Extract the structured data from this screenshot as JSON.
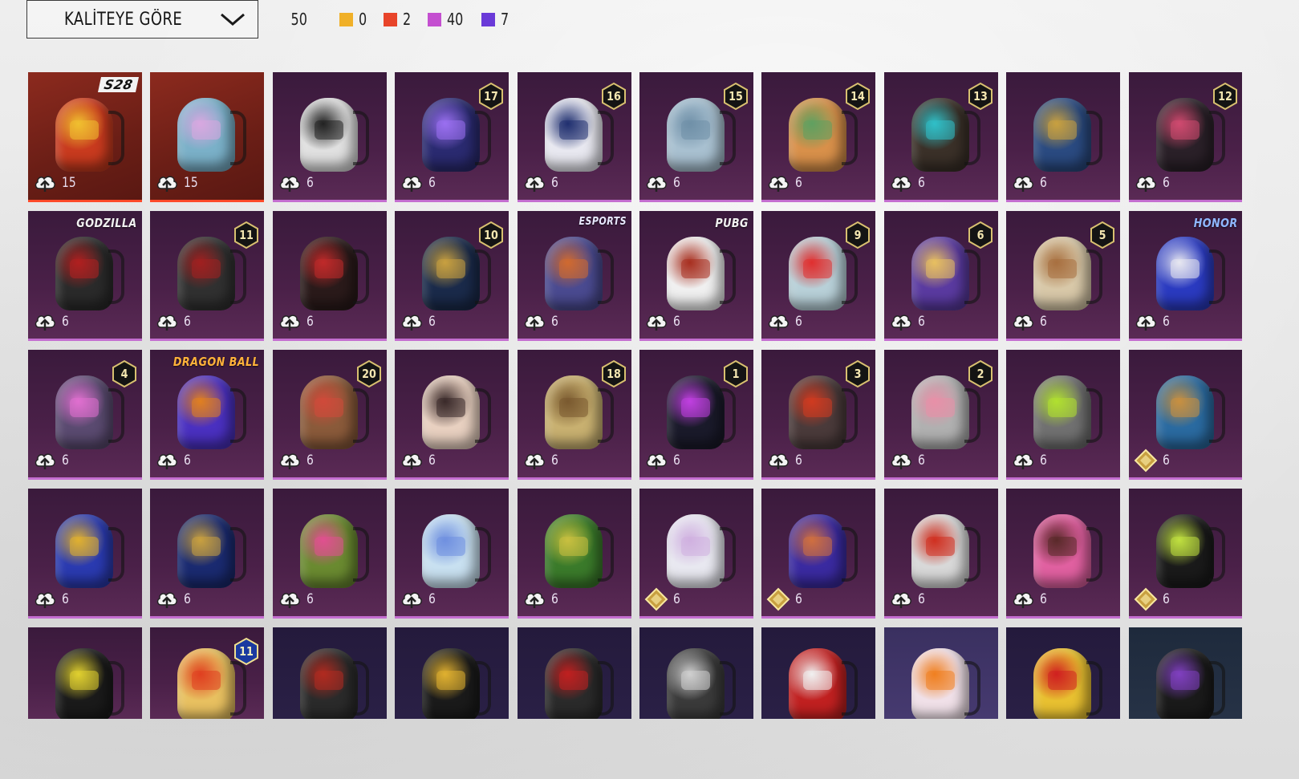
{
  "sort": {
    "label": "KALİTEYE GÖRE"
  },
  "counts": {
    "total": "50",
    "items": [
      {
        "color": "#f0b028",
        "value": "0"
      },
      {
        "color": "#e8442a",
        "value": "2"
      },
      {
        "color": "#c44fd0",
        "value": "40"
      },
      {
        "color": "#6a3ad8",
        "value": "7"
      }
    ]
  },
  "items": [
    {
      "tier": "red",
      "badge": "S28",
      "badge_type": "tag",
      "cost_icon": "upgrade",
      "cost": "15",
      "pack": "#c83a1e",
      "accent": "#f0c030"
    },
    {
      "tier": "red",
      "cost_icon": "upgrade",
      "cost": "15",
      "pack": "#7ab0c8",
      "accent": "#d8a8e0"
    },
    {
      "tier": "purple",
      "cost_icon": "upgrade",
      "cost": "6",
      "pack": "#e0e0e0",
      "accent": "#222222"
    },
    {
      "tier": "purple",
      "level": "17",
      "cost_icon": "upgrade",
      "cost": "6",
      "pack": "#2a2a70",
      "accent": "#9a70f0"
    },
    {
      "tier": "purple",
      "level": "16",
      "cost_icon": "upgrade",
      "cost": "6",
      "pack": "#e8e8f0",
      "accent": "#203070"
    },
    {
      "tier": "purple",
      "level": "15",
      "cost_icon": "upgrade",
      "cost": "6",
      "pack": "#a8c0d0",
      "accent": "#7090a8"
    },
    {
      "tier": "purple",
      "level": "14",
      "cost_icon": "upgrade",
      "cost": "6",
      "pack": "#d8904a",
      "accent": "#60a060"
    },
    {
      "tier": "purple",
      "level": "13",
      "cost_icon": "upgrade",
      "cost": "6",
      "pack": "#3a3028",
      "accent": "#30c0c8"
    },
    {
      "tier": "purple",
      "cost_icon": "upgrade",
      "cost": "6",
      "pack": "#2a4a80",
      "accent": "#c8a040"
    },
    {
      "tier": "purple",
      "level": "12",
      "cost_icon": "upgrade",
      "cost": "6",
      "pack": "#2a2028",
      "accent": "#d04a70"
    },
    {
      "tier": "purple",
      "badge": "GODZILLA",
      "badge_type": "text",
      "cost_icon": "upgrade",
      "cost": "6",
      "pack": "#2a2a2a",
      "accent": "#b02020"
    },
    {
      "tier": "purple",
      "level": "11",
      "cost_icon": "upgrade",
      "cost": "6",
      "pack": "#303030",
      "accent": "#a02020"
    },
    {
      "tier": "purple",
      "cost_icon": "upgrade",
      "cost": "6",
      "pack": "#2a1a1a",
      "accent": "#c02a2a"
    },
    {
      "tier": "purple",
      "level": "10",
      "cost_icon": "upgrade",
      "cost": "6",
      "pack": "#1a2a4a",
      "accent": "#c8a040"
    },
    {
      "tier": "purple",
      "badge": "ESPORTS",
      "badge_type": "esports",
      "cost_icon": "upgrade",
      "cost": "6",
      "pack": "#4a4a90",
      "accent": "#d06a30"
    },
    {
      "tier": "purple",
      "badge": "PUBG",
      "badge_type": "text",
      "cost_icon": "upgrade",
      "cost": "6",
      "pack": "#f0f0f0",
      "accent": "#a83020"
    },
    {
      "tier": "purple",
      "level": "9",
      "cost_icon": "upgrade",
      "cost": "6",
      "pack": "#b8d0d8",
      "accent": "#e03030"
    },
    {
      "tier": "purple",
      "level": "6",
      "cost_icon": "upgrade",
      "cost": "6",
      "pack": "#5a3aa0",
      "accent": "#e8c060"
    },
    {
      "tier": "purple",
      "level": "5",
      "cost_icon": "upgrade",
      "cost": "6",
      "pack": "#d8c8a8",
      "accent": "#a87040"
    },
    {
      "tier": "purple",
      "badge": "HONOR",
      "badge_type": "blue",
      "cost_icon": "upgrade",
      "cost": "6",
      "pack": "#2a3ac0",
      "accent": "#e8e8f0"
    },
    {
      "tier": "purple",
      "level": "4",
      "cost_icon": "upgrade",
      "cost": "6",
      "pack": "#5a4a70",
      "accent": "#e070d0"
    },
    {
      "tier": "purple",
      "badge": "DRAGON BALL",
      "badge_type": "orange",
      "cost_icon": "upgrade",
      "cost": "6",
      "pack": "#4a30c0",
      "accent": "#e08020"
    },
    {
      "tier": "purple",
      "level": "20",
      "cost_icon": "upgrade",
      "cost": "6",
      "pack": "#8a5a3a",
      "accent": "#d04a3a"
    },
    {
      "tier": "purple",
      "cost_icon": "upgrade",
      "cost": "6",
      "pack": "#e8d0c0",
      "accent": "#3a2a2a"
    },
    {
      "tier": "purple",
      "level": "18",
      "cost_icon": "upgrade",
      "cost": "6",
      "pack": "#c8b070",
      "accent": "#7a5a30"
    },
    {
      "tier": "purple",
      "level": "1",
      "cost_icon": "upgrade",
      "cost": "6",
      "pack": "#1a1a2a",
      "accent": "#c040e0"
    },
    {
      "tier": "purple",
      "level": "3",
      "cost_icon": "upgrade",
      "cost": "6",
      "pack": "#4a3a3a",
      "accent": "#d03a20"
    },
    {
      "tier": "purple",
      "level": "2",
      "cost_icon": "upgrade",
      "cost": "6",
      "pack": "#b0b0b0",
      "accent": "#e890a8"
    },
    {
      "tier": "purple",
      "cost_icon": "upgrade",
      "cost": "6",
      "pack": "#707070",
      "accent": "#b0e030"
    },
    {
      "tier": "purple",
      "cost_icon": "coin",
      "cost": "6",
      "pack": "#2a6aa0",
      "accent": "#c89040"
    },
    {
      "tier": "purple",
      "cost_icon": "upgrade",
      "cost": "6",
      "pack": "#2a3ab0",
      "accent": "#e0b030"
    },
    {
      "tier": "purple",
      "cost_icon": "upgrade",
      "cost": "6",
      "pack": "#1a2a70",
      "accent": "#c8a040"
    },
    {
      "tier": "purple",
      "cost_icon": "upgrade",
      "cost": "6",
      "pack": "#6a8a30",
      "accent": "#e05090"
    },
    {
      "tier": "purple",
      "cost_icon": "upgrade",
      "cost": "6",
      "pack": "#c8e0f0",
      "accent": "#7090e0"
    },
    {
      "tier": "purple",
      "cost_icon": "upgrade",
      "cost": "6",
      "pack": "#3a7a2a",
      "accent": "#c8c040"
    },
    {
      "tier": "purple",
      "cost_icon": "coin",
      "cost": "6",
      "pack": "#e8e8f0",
      "accent": "#d0b0e0"
    },
    {
      "tier": "purple",
      "cost_icon": "coin",
      "cost": "6",
      "pack": "#3a2aa0",
      "accent": "#d07040"
    },
    {
      "tier": "purple",
      "cost_icon": "upgrade",
      "cost": "6",
      "pack": "#d8d8d8",
      "accent": "#d03020"
    },
    {
      "tier": "purple",
      "cost_icon": "upgrade",
      "cost": "6",
      "pack": "#e060a0",
      "accent": "#5a2a2a"
    },
    {
      "tier": "purple",
      "cost_icon": "coin",
      "cost": "6",
      "pack": "#1a1a1a",
      "accent": "#c0e040"
    },
    {
      "tier": "purple",
      "cost_icon": "none",
      "pack": "#1a1a1a",
      "accent": "#e0d030"
    },
    {
      "tier": "purple",
      "level": "11",
      "level_type": "blue",
      "cost_icon": "none",
      "pack": "#e8c060",
      "accent": "#e04020"
    },
    {
      "tier": "dark",
      "cost_icon": "none",
      "pack": "#2a2a2a",
      "accent": "#b02a20"
    },
    {
      "tier": "dark",
      "cost_icon": "none",
      "pack": "#1a1a1a",
      "accent": "#e0b030"
    },
    {
      "tier": "dark",
      "cost_icon": "none",
      "pack": "#2a2a2a",
      "accent": "#c02020"
    },
    {
      "tier": "dark",
      "cost_icon": "none",
      "pack": "#3a3a3a",
      "accent": "#d0d0d0"
    },
    {
      "tier": "dark",
      "cost_icon": "none",
      "pack": "#c02020",
      "accent": "#f0f0f0"
    },
    {
      "tier": "lav",
      "cost_icon": "none",
      "pack": "#f0e0e8",
      "accent": "#f08020"
    },
    {
      "tier": "dark",
      "cost_icon": "none",
      "pack": "#e8c030",
      "accent": "#d02020"
    },
    {
      "tier": "blue",
      "cost_icon": "none",
      "pack": "#1a1a1a",
      "accent": "#8040c0"
    }
  ]
}
